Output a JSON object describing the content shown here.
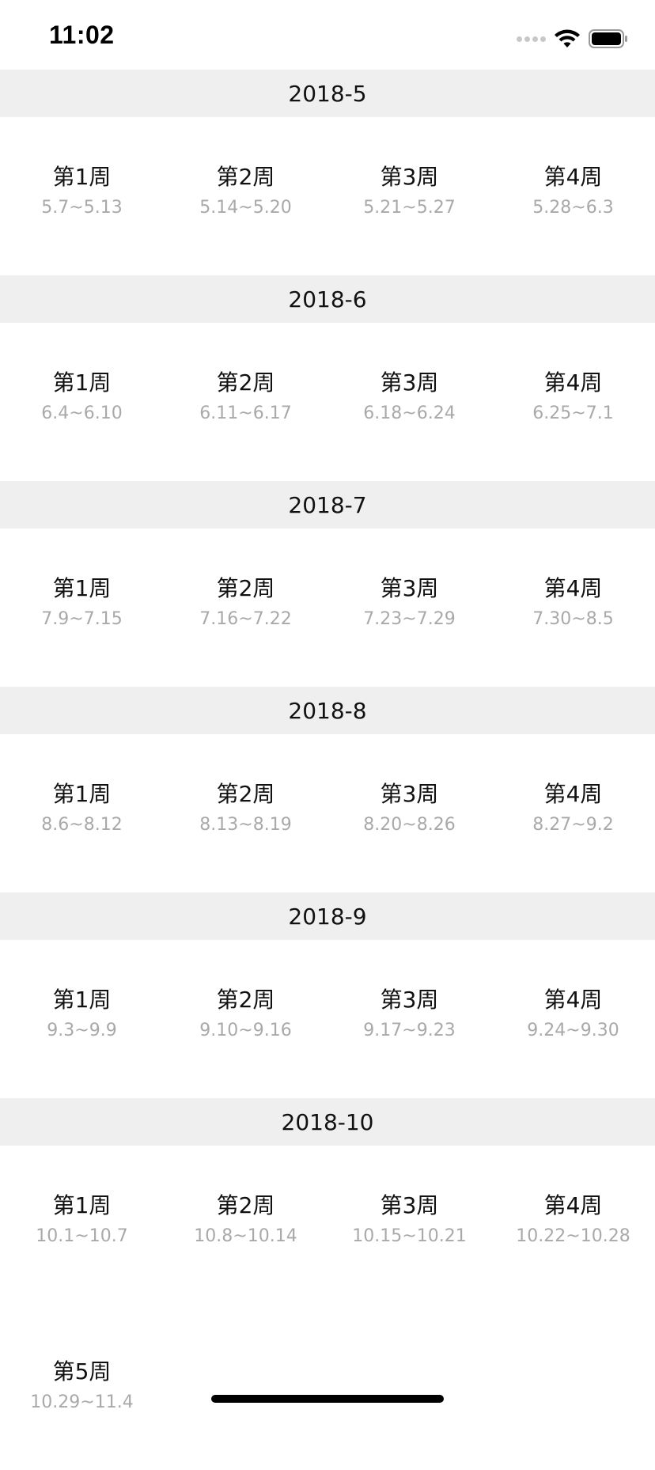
{
  "status_bar": {
    "time": "11:02"
  },
  "sections": [
    {
      "month": "2018-5",
      "weeks": [
        {
          "name": "第1周",
          "range": "5.7~5.13"
        },
        {
          "name": "第2周",
          "range": "5.14~5.20"
        },
        {
          "name": "第3周",
          "range": "5.21~5.27"
        },
        {
          "name": "第4周",
          "range": "5.28~6.3"
        }
      ]
    },
    {
      "month": "2018-6",
      "weeks": [
        {
          "name": "第1周",
          "range": "6.4~6.10"
        },
        {
          "name": "第2周",
          "range": "6.11~6.17"
        },
        {
          "name": "第3周",
          "range": "6.18~6.24"
        },
        {
          "name": "第4周",
          "range": "6.25~7.1"
        }
      ]
    },
    {
      "month": "2018-7",
      "weeks": [
        {
          "name": "第1周",
          "range": "7.9~7.15"
        },
        {
          "name": "第2周",
          "range": "7.16~7.22"
        },
        {
          "name": "第3周",
          "range": "7.23~7.29"
        },
        {
          "name": "第4周",
          "range": "7.30~8.5"
        }
      ]
    },
    {
      "month": "2018-8",
      "weeks": [
        {
          "name": "第1周",
          "range": "8.6~8.12"
        },
        {
          "name": "第2周",
          "range": "8.13~8.19"
        },
        {
          "name": "第3周",
          "range": "8.20~8.26"
        },
        {
          "name": "第4周",
          "range": "8.27~9.2"
        }
      ]
    },
    {
      "month": "2018-9",
      "weeks": [
        {
          "name": "第1周",
          "range": "9.3~9.9"
        },
        {
          "name": "第2周",
          "range": "9.10~9.16"
        },
        {
          "name": "第3周",
          "range": "9.17~9.23"
        },
        {
          "name": "第4周",
          "range": "9.24~9.30"
        }
      ]
    },
    {
      "month": "2018-10",
      "weeks": [
        {
          "name": "第1周",
          "range": "10.1~10.7"
        },
        {
          "name": "第2周",
          "range": "10.8~10.14"
        },
        {
          "name": "第3周",
          "range": "10.15~10.21"
        },
        {
          "name": "第4周",
          "range": "10.22~10.28"
        },
        {
          "name": "第5周",
          "range": "10.29~11.4"
        }
      ]
    }
  ],
  "colors": {
    "header_bg": "#efefef",
    "range_text": "#a9a9a9"
  },
  "icons": [
    "signal-dots-icon",
    "wifi-icon",
    "battery-icon"
  ]
}
